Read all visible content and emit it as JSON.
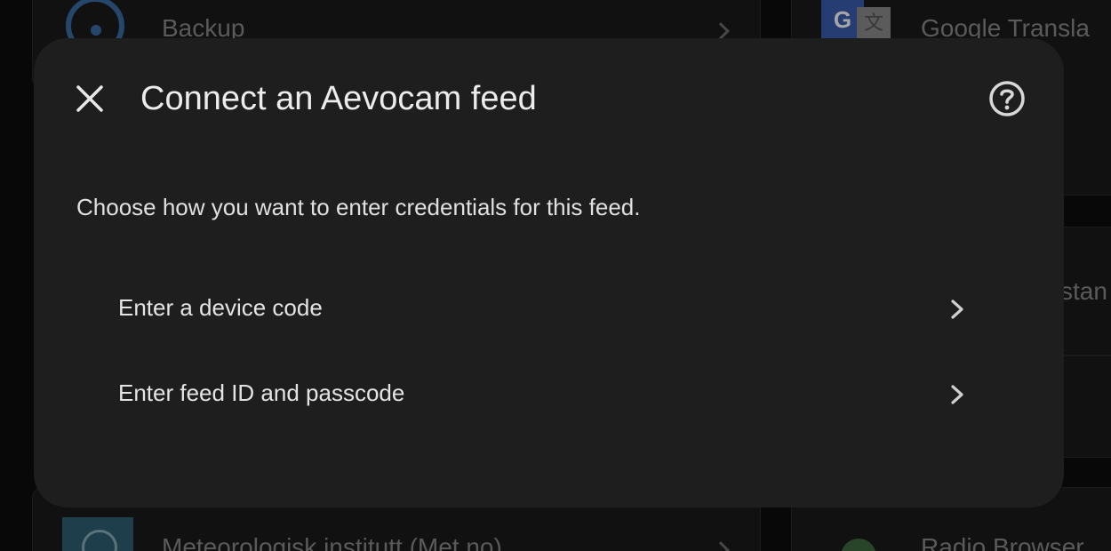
{
  "background": {
    "backup_label": "Backup",
    "google_translate_label": "Google Transla",
    "partial_label": "stan",
    "met_label": "Meteorologisk institutt (Met.no)",
    "radio_browser_label": "Radio Browser",
    "google_icon_letter": "G",
    "translate_icon_glyph": "文"
  },
  "dialog": {
    "title": "Connect an Aevocam feed",
    "description": "Choose how you want to enter credentials for this feed.",
    "options": [
      {
        "label": "Enter a device code"
      },
      {
        "label": "Enter feed ID and passcode"
      }
    ],
    "close_icon": "close-icon",
    "help_icon": "help-icon"
  },
  "colors": {
    "dialog_bg": "#1e1e1e",
    "page_bg": "#0d0d0d",
    "text_primary": "#ececec",
    "accent_blue": "#3a6ea5"
  }
}
